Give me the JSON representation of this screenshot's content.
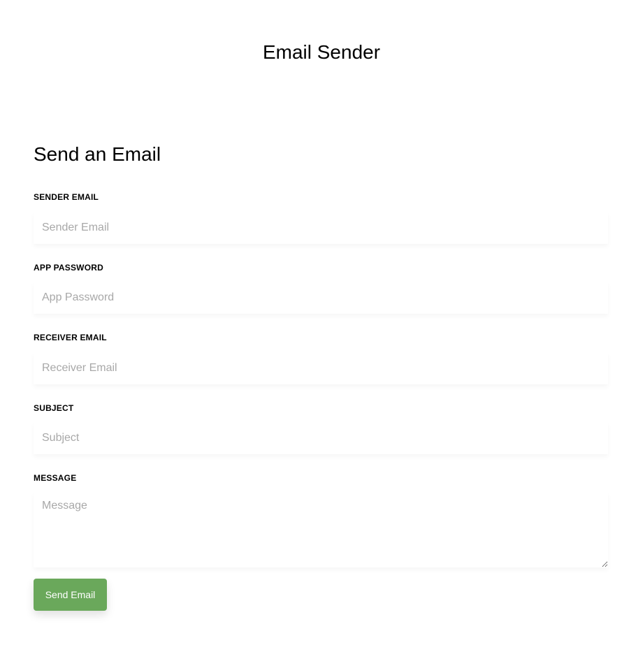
{
  "app": {
    "title": "Email Sender"
  },
  "form": {
    "heading": "Send an Email",
    "fields": {
      "sender_email": {
        "label": "SENDER EMAIL",
        "placeholder": "Sender Email",
        "value": ""
      },
      "app_password": {
        "label": "APP PASSWORD",
        "placeholder": "App Password",
        "value": ""
      },
      "receiver_email": {
        "label": "RECEIVER EMAIL",
        "placeholder": "Receiver Email",
        "value": ""
      },
      "subject": {
        "label": "SUBJECT",
        "placeholder": "Subject",
        "value": ""
      },
      "message": {
        "label": "MESSAGE",
        "placeholder": "Message",
        "value": ""
      }
    },
    "submit_label": "Send Email"
  },
  "colors": {
    "button_background": "#6aa85b",
    "button_text": "#ffffff",
    "placeholder_text": "#a8a8a8"
  }
}
